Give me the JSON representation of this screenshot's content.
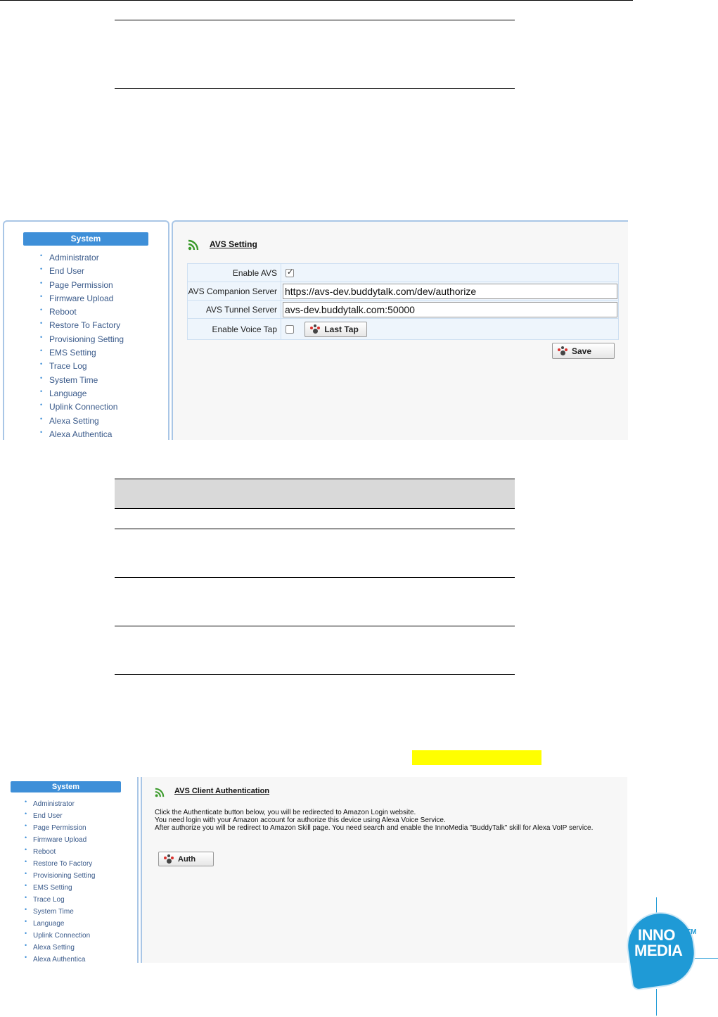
{
  "panel1": {
    "sidebar_header": "System",
    "menu": [
      "Administrator",
      "End User",
      "Page Permission",
      "Firmware Upload",
      "Reboot",
      "Restore To Factory",
      "Provisioning Setting",
      "EMS Setting",
      "Trace Log",
      "System Time",
      "Language",
      "Uplink Connection",
      "Alexa Setting",
      "Alexa Authentica"
    ],
    "title": "AVS Setting",
    "fields": {
      "enable_avs_label": "Enable AVS",
      "companion_label": "AVS Companion Server",
      "companion_value": "https://avs-dev.buddytalk.com/dev/authorize",
      "tunnel_label": "AVS Tunnel Server",
      "tunnel_value": "avs-dev.buddytalk.com:50000",
      "voice_tap_label": "Enable Voice Tap",
      "last_tap_label": "Last Tap"
    },
    "save_label": "Save"
  },
  "panel2": {
    "sidebar_header": "System",
    "menu": [
      "Administrator",
      "End User",
      "Page Permission",
      "Firmware Upload",
      "Reboot",
      "Restore To Factory",
      "Provisioning Setting",
      "EMS Setting",
      "Trace Log",
      "System Time",
      "Language",
      "Uplink Connection",
      "Alexa Setting",
      "Alexa Authentica"
    ],
    "title": "AVS Client Authentication",
    "lines": [
      "Click the Authenticate button below, you will be redirected to Amazon Login website.",
      "You need login with your Amazon account for authorize this device using Alexa Voice Service.",
      "After authorize you will be redirect to Amazon Skill page. You need search and enable the InnoMedia \"BuddyTalk\" skill for Alexa VoIP service."
    ],
    "auth_label": "Auth"
  },
  "logo": {
    "line1": "INNO",
    "line2": "MEDIA",
    "tm": "TM"
  },
  "colors": {
    "accent": "#3e8fd8",
    "panel_border": "#a9c6e6",
    "highlight": "#ffff00",
    "logo": "#1f9ad6"
  }
}
